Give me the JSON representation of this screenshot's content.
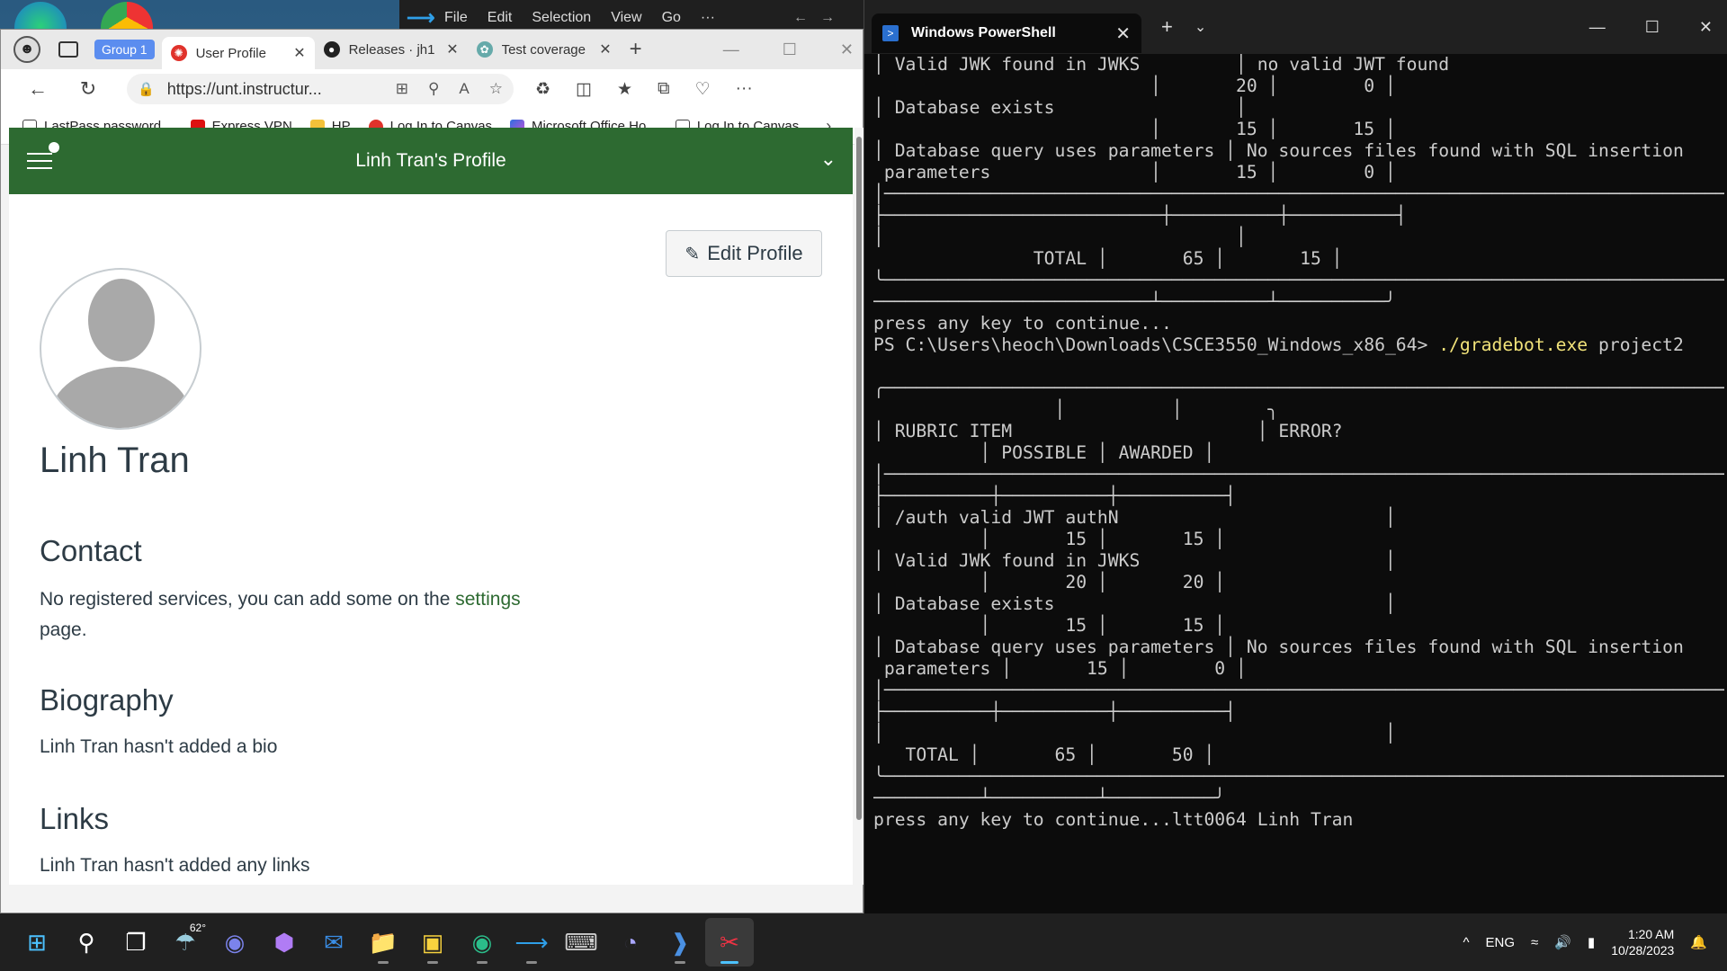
{
  "vscode": {
    "menus": [
      "File",
      "Edit",
      "Selection",
      "View",
      "Go",
      "···"
    ]
  },
  "browser": {
    "group_label": "Group 1",
    "tabs": [
      {
        "label": "User Profile",
        "active": true
      },
      {
        "label": "Releases · jh1",
        "active": false
      },
      {
        "label": "Test coverage",
        "active": false
      }
    ],
    "url": "https://unt.instructur...",
    "bookmarks": [
      "LastPass password...",
      "Express VPN",
      "HP",
      "Log In to Canvas",
      "Microsoft Office Ho...",
      "Log In to Canvas"
    ]
  },
  "canvas": {
    "header_title": "Linh Tran's Profile",
    "edit_profile_label": "Edit Profile",
    "name": "Linh Tran",
    "contact_heading": "Contact",
    "contact_text_pre": "No registered services, you can add some on the ",
    "contact_link": "settings",
    "contact_text_post": "page.",
    "bio_heading": "Biography",
    "bio_text": "Linh Tran hasn't added a bio",
    "links_heading": "Links",
    "links_text": "Linh Tran hasn't added any links"
  },
  "terminal": {
    "title": "Windows PowerShell",
    "output_before": "│ Valid JWK found in JWKS         │ no valid JWT found\n                          │       20 │        0 │\n│ Database exists                 │\n                          │       15 │       15 │\n│ Database query uses parameters │ No sources files found with SQL insertion\n parameters               │       15 │        0 │\n│────────────────────────────────────────────────────────────────────────────────\n├──────────────────────────┼──────────┼──────────┤\n│                                 │\n               TOTAL │       65 │       15 │\n╰────────────────────────────────────────────────────────────────────────────────\n──────────────────────────┴──────────┴──────────╯\npress any key to continue...",
    "prompt": "PS C:\\Users\\heoch\\Downloads\\CSCE3550_Windows_x86_64> ",
    "command": "./gradebot.exe",
    "command_arg": " project2",
    "output_after": "\n╭────────────────────────────────────────────────────────────────────────────────\n                 │          │        ╮\n│ RUBRIC ITEM                       │ ERROR?\n          │ POSSIBLE │ AWARDED │\n│─────────────────────────────────────────────────────────────────────────────────\n├──────────┼──────────┼──────────┤\n│ /auth valid JWT authN                         │\n          │       15 │       15 │\n│ Valid JWK found in JWKS                       │\n          │       20 │       20 │\n│ Database exists                               │\n          │       15 │       15 │\n│ Database query uses parameters │ No sources files found with SQL insertion\n parameters │       15 │        0 │\n│─────────────────────────────────────────────────────────────────────────────────\n├──────────┼──────────┼──────────┤\n│                                               │\n   TOTAL │       65 │       50 │\n╰─────────────────────────────────────────────────────────────────────────────────\n──────────┴──────────┴──────────╯\npress any key to continue...ltt0064 Linh Tran"
  },
  "taskbar": {
    "weather_temp": "62°",
    "language": "ENG",
    "time": "1:20 AM",
    "date": "10/28/2023"
  }
}
